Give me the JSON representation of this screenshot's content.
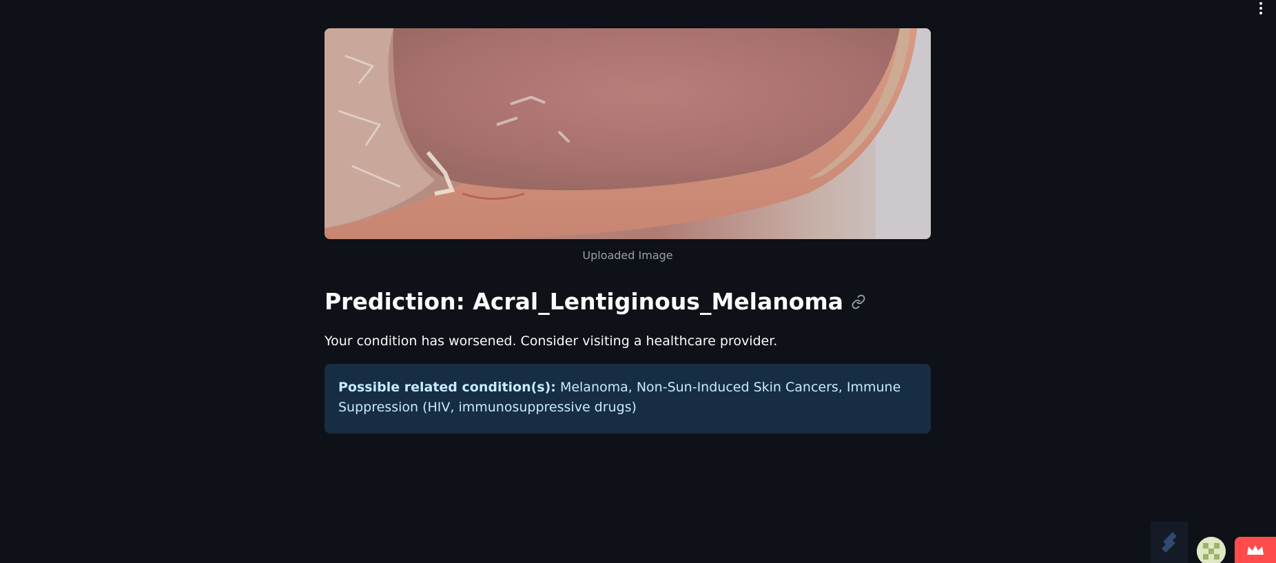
{
  "image": {
    "caption": "Uploaded Image",
    "icon": "skin-lesion-photo"
  },
  "prediction": {
    "heading": "Prediction: Acral_Lentiginous_Melanoma",
    "link_icon": "link-icon"
  },
  "message": "Your condition has worsened. Consider visiting a healthcare provider.",
  "info": {
    "label": "Possible related condition(s):",
    "text": " Melanoma, Non-Sun-Induced Skin Cancers, Immune Suppression (HIV, immunosuppressive drugs)"
  },
  "colors": {
    "background": "#0e1117",
    "info_bg": "#172d43",
    "info_text": "#c7ebff",
    "accent": "#ff4b4b"
  },
  "icons": {
    "menu": "more-vertical-icon",
    "streamlit": "streamlit-logo-icon",
    "avatar": "user-avatar",
    "crown": "crown-icon"
  }
}
